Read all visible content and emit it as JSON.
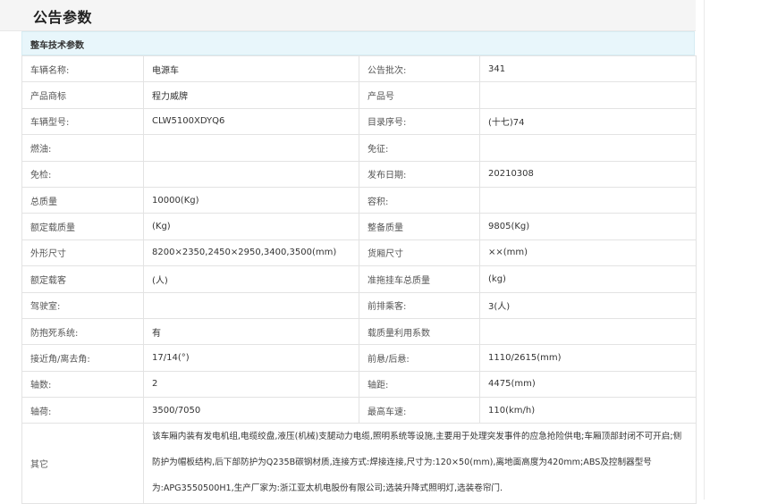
{
  "page": {
    "title": "公告参数"
  },
  "section": {
    "title": "整车技术参数"
  },
  "rows": [
    {
      "l1": "车辆名称:",
      "v1": "电源车",
      "l2": "公告批次:",
      "v2": "341"
    },
    {
      "l1": "产品商标",
      "v1": "程力威牌",
      "l2": "产品号",
      "v2": ""
    },
    {
      "l1": "车辆型号:",
      "v1": "CLW5100XDYQ6",
      "l2": "目录序号:",
      "v2": "(十七)74"
    },
    {
      "l1": "燃油:",
      "v1": "",
      "l2": "免征:",
      "v2": ""
    },
    {
      "l1": "免检:",
      "v1": "",
      "l2": "发布日期:",
      "v2": "20210308"
    },
    {
      "l1": "总质量",
      "v1": "10000(Kg)",
      "l2": "容积:",
      "v2": ""
    },
    {
      "l1": "额定载质量",
      "v1": "(Kg)",
      "l2": "整备质量",
      "v2": "9805(Kg)"
    },
    {
      "l1": "外形尺寸",
      "v1": "8200×2350,2450×2950,3400,3500(mm)",
      "l2": "货厢尺寸",
      "v2": "××(mm)"
    },
    {
      "l1": "额定载客",
      "v1": "(人)",
      "l2": "准拖挂车总质量",
      "v2": "(kg)"
    },
    {
      "l1": "驾驶室:",
      "v1": "",
      "l2": "前排乘客:",
      "v2": "3(人)"
    },
    {
      "l1": "防抱死系统:",
      "v1": "有",
      "l2": "载质量利用系数",
      "v2": ""
    },
    {
      "l1": "接近角/离去角:",
      "v1": "17/14(°)",
      "l2": "前悬/后悬:",
      "v2": "1110/2615(mm)"
    },
    {
      "l1": "轴数:",
      "v1": "2",
      "l2": "轴距:",
      "v2": "4475(mm)"
    },
    {
      "l1": "轴荷:",
      "v1": "3500/7050",
      "l2": "最高车速:",
      "v2": "110(km/h)"
    }
  ],
  "other": {
    "label": "其它",
    "value": "该车厢内装有发电机组,电缆绞盘,液压(机械)支腿动力电缆,照明系统等设施,主要用于处理突发事件的应急抢险供电;车厢顶部封闭不可开启;侧防护为帽板结构,后下部防护为Q235B碳钢材质,连接方式:焊接连接,尺寸为:120×50(mm),离地面高度为420mm;ABS及控制器型号为:APG3550500H1,生产厂家为:浙江亚太机电股份有限公司;选装升降式照明灯,选装卷帘门."
  }
}
